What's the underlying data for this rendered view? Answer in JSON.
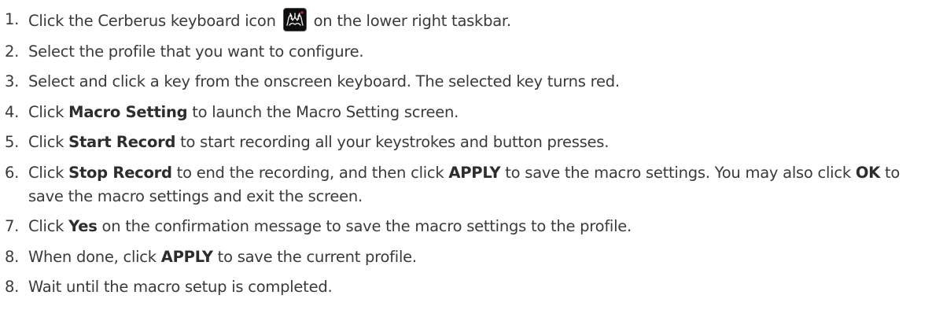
{
  "steps": [
    {
      "number": "1.",
      "text_before": "Click the Cerberus keyboard icon",
      "icon": "cerberus-keyboard-icon",
      "text_after": "on the lower right taskbar."
    },
    {
      "number": "2.",
      "text": "Select the profile that you want to configure."
    },
    {
      "number": "3.",
      "text": "Select and click a key from the onscreen keyboard. The selected key turns red."
    },
    {
      "number": "4.",
      "pre": "Click",
      "bold": "Macro Setting",
      "post": "to launch the Macro Setting screen."
    },
    {
      "number": "5.",
      "pre": "Click",
      "bold": "Start Record",
      "post": "to start recording all your keystrokes and button presses."
    },
    {
      "number": "6.",
      "pre": "Click",
      "bold": "Stop Record",
      "mid": "to end the recording, and then click",
      "bold2": "APPLY",
      "mid2": "to save the macro settings. You may also click",
      "bold3": "OK",
      "post": "to save the macro settings and exit the screen."
    },
    {
      "number": "7.",
      "pre": "Click",
      "bold": "Yes",
      "post": "on the confirmation message to save the macro settings to the profile."
    },
    {
      "number": "8.",
      "pre": "When done, click",
      "bold": "APPLY",
      "post": "to save the current profile."
    },
    {
      "number": "8.",
      "text": "Wait until the macro setup is completed."
    }
  ]
}
